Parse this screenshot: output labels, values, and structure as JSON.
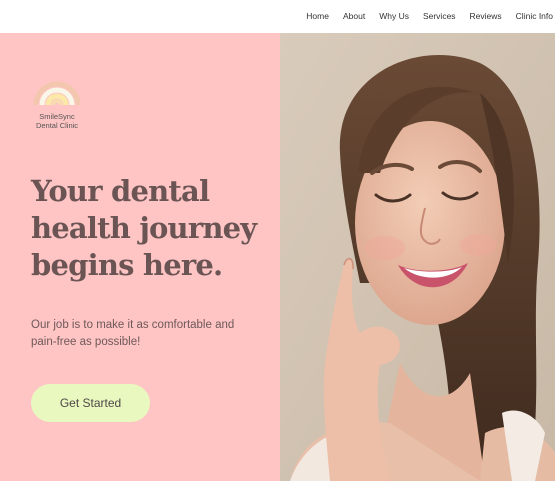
{
  "nav": {
    "items": [
      {
        "label": "Home"
      },
      {
        "label": "About"
      },
      {
        "label": "Why Us"
      },
      {
        "label": "Services"
      },
      {
        "label": "Reviews"
      },
      {
        "label": "Clinic Info"
      }
    ]
  },
  "brand": {
    "name_line1": "SmileSync",
    "name_line2": "Dental Clinic",
    "logo_colors": [
      "#f7dcb0",
      "#fbe9a8",
      "#f9f7e8",
      "#f3c7ad"
    ]
  },
  "hero": {
    "headline_line1": "Your dental",
    "headline_line2": "health journey",
    "headline_line3": "begins here.",
    "subtext_line1": "Our job is to make it as comfortable and",
    "subtext_line2": "pain-free as possible!",
    "cta_label": "Get Started",
    "image_subject": "smiling-woman-photo"
  },
  "colors": {
    "hero_left_bg": "#ffc4c4",
    "cta_bg": "#e9f8bf",
    "headline": "#6b5454"
  }
}
